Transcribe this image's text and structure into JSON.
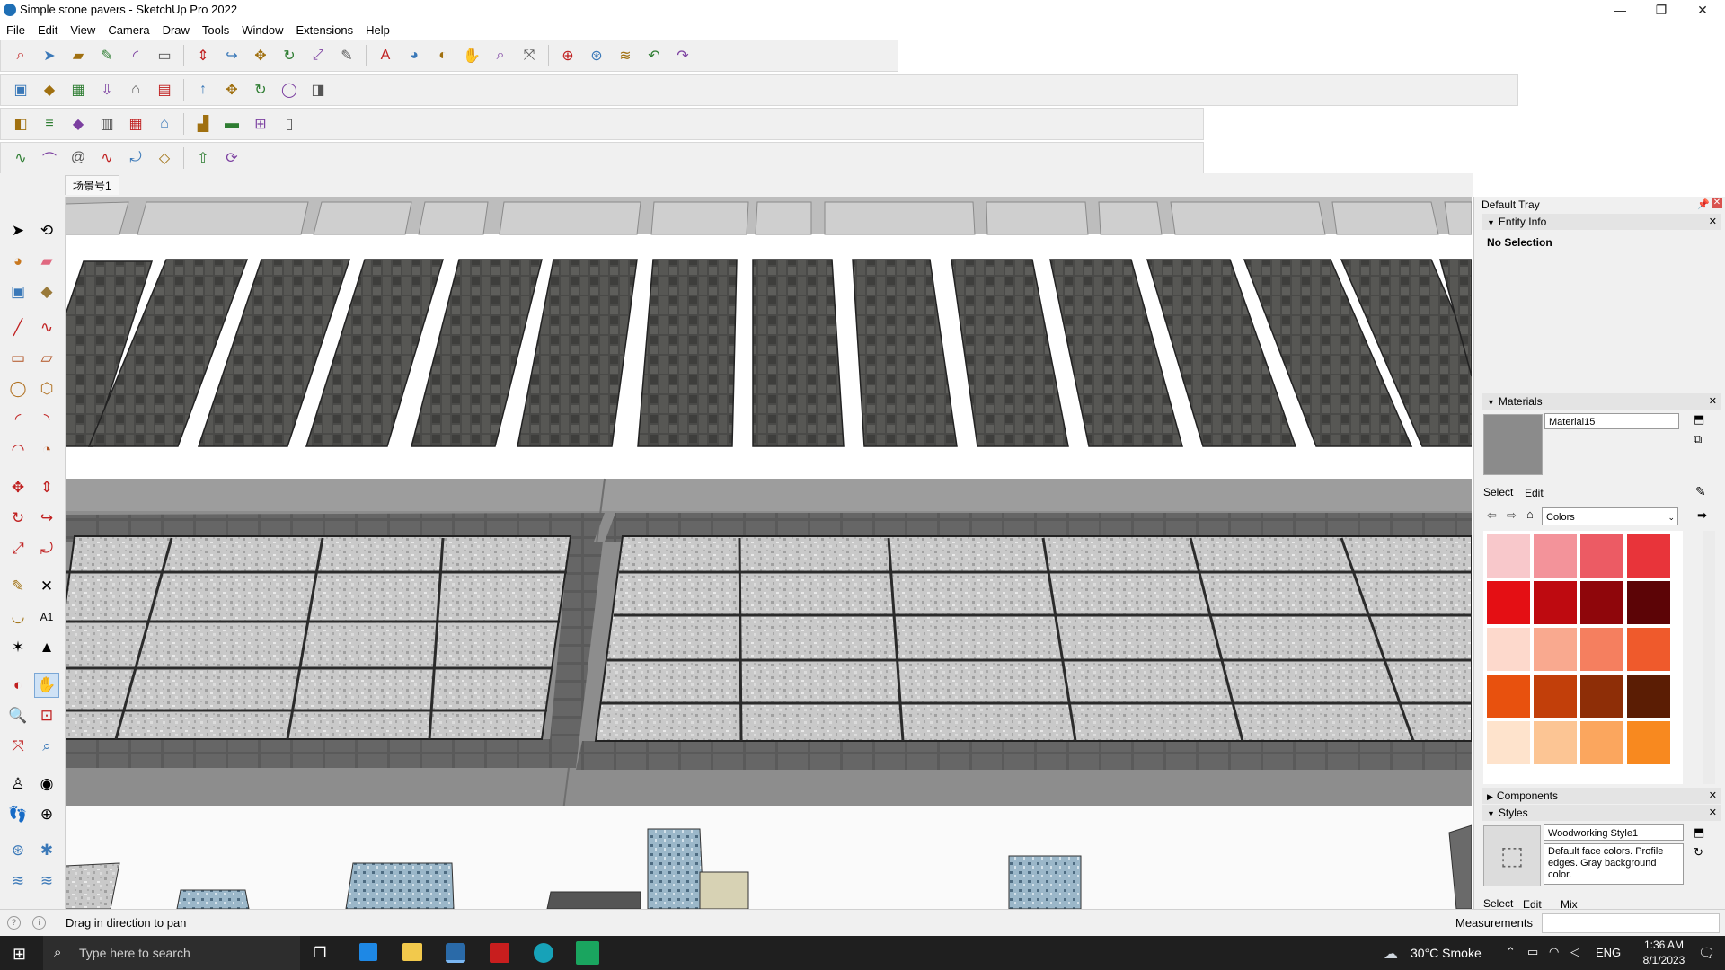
{
  "window": {
    "title": "Simple stone pavers - SketchUp Pro 2022",
    "minimize": "—",
    "maximize": "❐",
    "close": "✕"
  },
  "menu": [
    "File",
    "Edit",
    "View",
    "Camera",
    "Draw",
    "Tools",
    "Window",
    "Extensions",
    "Help"
  ],
  "toolbars": {
    "row1": [
      "search-icon",
      "select-icon",
      "eraser-icon",
      "pencil-icon",
      "arc-icon",
      "rectangle-icon",
      "pushpull-icon",
      "followme-icon",
      "move-icon",
      "rotate-icon",
      "scale-icon",
      "tape-icon",
      "text-icon",
      "paint-icon",
      "orbit-icon",
      "pan-icon",
      "zoom-icon",
      "zoomextents-icon",
      "section-icon",
      "warehouse-icon",
      "extension-icon",
      "undo-icon",
      "redo-icon"
    ],
    "row2": [
      "box-icon",
      "solid-icon",
      "sandbox-icon",
      "import-icon",
      "house-icon",
      "group-icon",
      "arrow-icon",
      "move-icon",
      "rotate-icon",
      "cylinder-icon",
      "materials-icon"
    ],
    "row3": [
      "cube-icon",
      "layer-icon",
      "tag-icon",
      "fence-icon",
      "grid-icon",
      "roof-icon",
      "stairs-icon",
      "wall-icon",
      "window-icon",
      "door-icon"
    ],
    "row4": [
      "curve-icon",
      "bezier-icon",
      "spiral-icon",
      "freehand-icon",
      "offset-icon",
      "loft-icon",
      "extrude-icon",
      "sweep-icon"
    ]
  },
  "scene_tab": "场景号1",
  "tray": {
    "title": "Default Tray",
    "entity_info": {
      "header": "Entity Info",
      "selection": "No Selection"
    },
    "materials": {
      "header": "Materials",
      "name": "Material15",
      "tab_select": "Select",
      "tab_edit": "Edit",
      "library": "Colors",
      "swatches": [
        "#f8c8cb",
        "#f3939a",
        "#ec5b64",
        "#e8343a",
        "#e40f14",
        "#be0a10",
        "#8f060b",
        "#5c0406",
        "#fdd9cc",
        "#f9a98f",
        "#f57f5f",
        "#ef5a2c",
        "#e8510e",
        "#c23f0a",
        "#8e2e07",
        "#5b1d04",
        "#fee3cc",
        "#fcc594",
        "#fba65e",
        "#f8891f"
      ]
    },
    "components": {
      "header": "Components"
    },
    "styles": {
      "header": "Styles",
      "name": "Woodworking Style1",
      "description": "Default face colors. Profile edges. Gray background color.",
      "tab_select": "Select",
      "tab_edit": "Edit",
      "tab_mix": "Mix"
    }
  },
  "status": {
    "hint": "Drag in direction to pan",
    "measurements": "Measurements"
  },
  "taskbar": {
    "search_placeholder": "Type here to search",
    "weather": "30°C  Smoke",
    "lang": "ENG",
    "time": "1:36 AM",
    "date": "8/1/2023"
  }
}
